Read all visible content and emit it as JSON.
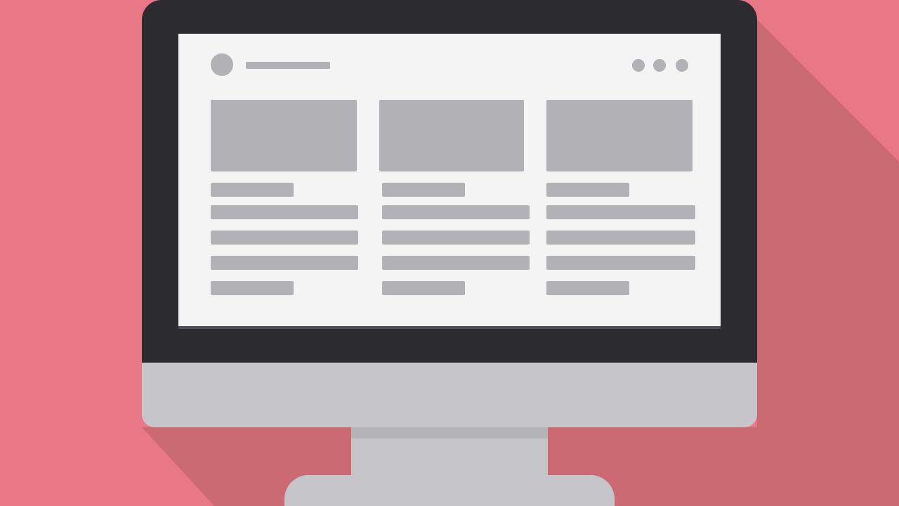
{
  "colors": {
    "background": "#E87885",
    "long_shadow": "#CB6A73",
    "bezel": "#2C2C30",
    "screen_bg": "#F4F4F4",
    "screen_bottom_line": "#50505A",
    "chin": "#C6C6CA",
    "neck": "#C6C6CA",
    "neck_shadow": "#B3B3B8",
    "base": "#C6C6CA",
    "placeholder": "#B2B2B6"
  },
  "icons": {
    "avatar": "avatar-placeholder-icon",
    "menu_dots": [
      "dot-icon",
      "dot-icon",
      "dot-icon"
    ]
  },
  "screen": {
    "header": {
      "avatar": true,
      "title_placeholder": true,
      "menu_dot_count": 3
    },
    "cards": [
      {
        "image": true,
        "bars": [
          "short",
          "long",
          "long",
          "long",
          "short"
        ]
      },
      {
        "image": true,
        "bars": [
          "short",
          "long",
          "long",
          "long",
          "short"
        ]
      },
      {
        "image": true,
        "bars": [
          "short",
          "long",
          "long",
          "long",
          "short"
        ]
      }
    ]
  }
}
